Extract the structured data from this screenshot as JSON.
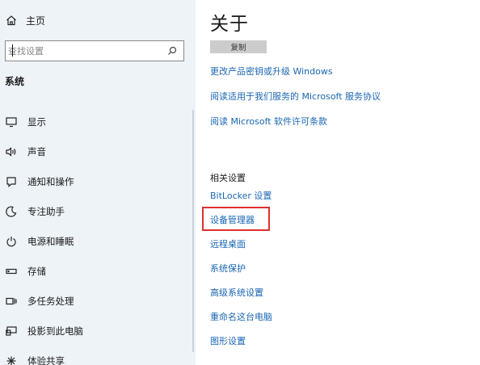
{
  "sidebar": {
    "home_label": "主页",
    "search": {
      "placeholder": "查找设置",
      "value": ""
    },
    "section_title": "系统",
    "items": [
      {
        "label": "显示",
        "icon": "display-icon"
      },
      {
        "label": "声音",
        "icon": "speaker-icon"
      },
      {
        "label": "通知和操作",
        "icon": "notification-icon"
      },
      {
        "label": "专注助手",
        "icon": "moon-icon"
      },
      {
        "label": "电源和睡眠",
        "icon": "power-icon"
      },
      {
        "label": "存储",
        "icon": "storage-icon"
      },
      {
        "label": "多任务处理",
        "icon": "multitasking-icon"
      },
      {
        "label": "投影到此电脑",
        "icon": "project-icon"
      },
      {
        "label": "体验共享",
        "icon": "share-icon"
      }
    ]
  },
  "main": {
    "title": "关于",
    "copy_button": "复制",
    "links": [
      "更改产品密钥或升级 Windows",
      "阅读适用于我们服务的 Microsoft 服务协议",
      "阅读 Microsoft 软件许可条款"
    ],
    "related_heading": "相关设置",
    "related_links": [
      "BitLocker 设置",
      "设备管理器",
      "远程桌面",
      "系统保护",
      "高级系统设置",
      "重命名这台电脑",
      "图形设置"
    ]
  },
  "colors": {
    "link": "#1a66b3",
    "sidebar_bg": "#eef3f8",
    "highlight": "#e03030"
  }
}
